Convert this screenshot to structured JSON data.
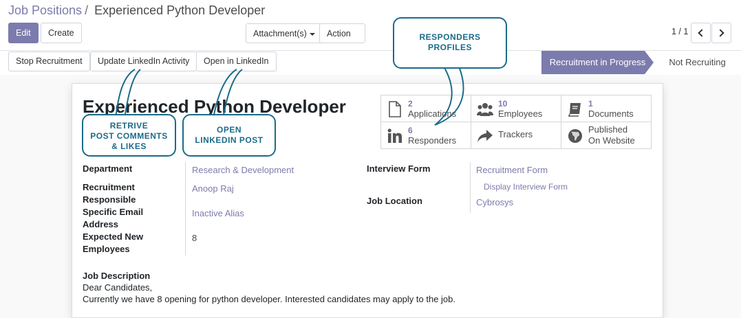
{
  "breadcrumb": {
    "parent": "Job Positions",
    "separator": "/",
    "current": "Experienced Python Developer"
  },
  "toolbar": {
    "edit": "Edit",
    "create": "Create",
    "attachments": "Attachment(s)",
    "action": "Action"
  },
  "pager": {
    "value": "1 / 1"
  },
  "status_buttons": {
    "stop": "Stop Recruitment",
    "update_linkedin": "Update LinkedIn Activity",
    "open_linkedin": "Open in LinkedIn"
  },
  "stages": {
    "active": "Recruitment in Progress",
    "next": "Not Recruiting"
  },
  "record": {
    "title": "Experienced Python Developer"
  },
  "smart_buttons": {
    "applications": {
      "count": "2",
      "label": "Applications",
      "icon": "document-icon"
    },
    "employees": {
      "count": "10",
      "label": "Employees",
      "icon": "users-icon"
    },
    "documents": {
      "count": "1",
      "label": "Documents",
      "icon": "book-icon"
    },
    "responders": {
      "count": "6",
      "label": "Responders",
      "icon": "linkedin-icon"
    },
    "trackers": {
      "label": "Trackers",
      "icon": "share-arrow-icon"
    },
    "website": {
      "label_line1": "Published",
      "label_line2": "On Website",
      "icon": "globe-icon"
    }
  },
  "fields": {
    "department": {
      "label": "Department",
      "value": "Research & Development"
    },
    "recruitment_responsible": {
      "label_line1": "Recruitment",
      "label_line2": "Responsible",
      "value": "Anoop Raj"
    },
    "specific_email": {
      "label_line1": "Specific Email",
      "label_line2": "Address",
      "value": "Inactive Alias"
    },
    "expected_new_employees": {
      "label_line1": "Expected New",
      "label_line2": "Employees",
      "value": "8"
    },
    "interview_form": {
      "label": "Interview Form",
      "value": "Recruitment Form",
      "action": "Display Interview Form"
    },
    "job_location": {
      "label": "Job Location",
      "value": "Cybrosys"
    }
  },
  "description": {
    "label": "Job Description",
    "line1": "Dear Candidates,",
    "line2": "Currently we have 8 opening for python developer. Interested candidates may apply to the job."
  },
  "callouts": {
    "responders": {
      "line1": "RESPONDERS",
      "line2": "PROFILES"
    },
    "retrive": {
      "line1": "RETRIVE",
      "line2": "POST COMMENTS",
      "line3": "& LIKES"
    },
    "open": {
      "line1": "OPEN",
      "line2": "LINKEDIN POST"
    }
  },
  "colors": {
    "primary": "#7c7bad",
    "callout": "#1a6b8a"
  }
}
